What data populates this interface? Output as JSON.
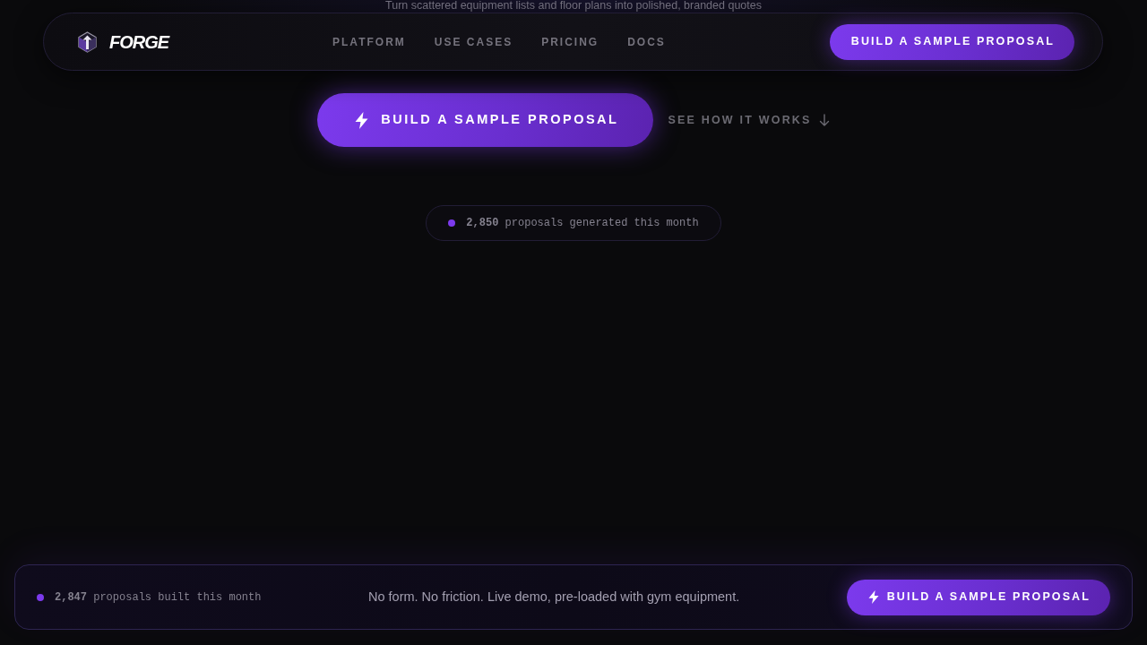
{
  "navbar": {
    "brand": "FORGE",
    "links": [
      "PLATFORM",
      "USE CASES",
      "PRICING",
      "DOCS"
    ],
    "cta": "BUILD A SAMPLE PROPOSAL"
  },
  "hero": {
    "subtitle": "Turn scattered equipment lists and floor plans into polished, branded quotes",
    "primary_button": "BUILD A SAMPLE PROPOSAL",
    "secondary_link": "SEE HOW IT WORKS",
    "stat": "**2,850** proposals generated this month"
  },
  "bottom_bar": {
    "stat": "**2,847** proposals built this month",
    "message": "No form. No friction. Live demo, pre-loaded with gym equipment.",
    "cta": "BUILD A SAMPLE PROPOSAL"
  }
}
